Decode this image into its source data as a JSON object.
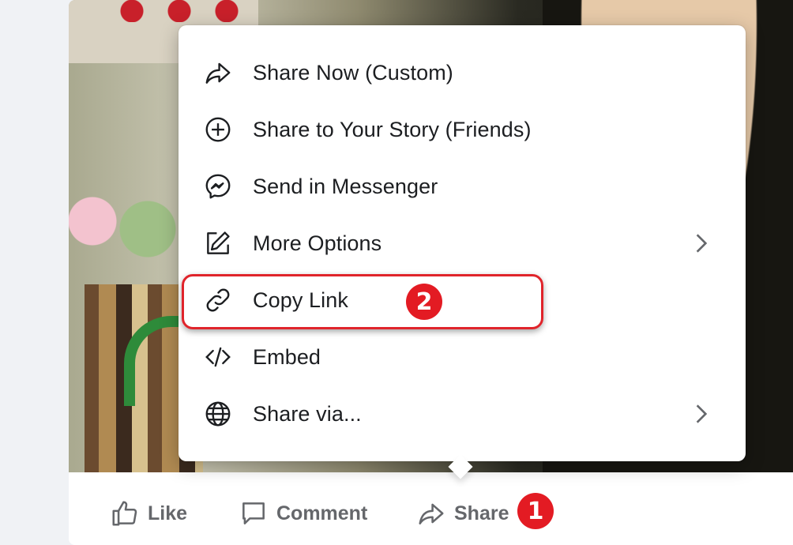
{
  "share_menu": {
    "items": [
      {
        "label": "Share Now (Custom)",
        "icon": "share-arrow-icon",
        "has_submenu": false
      },
      {
        "label": "Share to Your Story (Friends)",
        "icon": "plus-circle-icon",
        "has_submenu": false
      },
      {
        "label": "Send in Messenger",
        "icon": "messenger-icon",
        "has_submenu": false
      },
      {
        "label": "More Options",
        "icon": "edit-icon",
        "has_submenu": true
      },
      {
        "label": "Copy Link",
        "icon": "link-icon",
        "has_submenu": false
      },
      {
        "label": "Embed",
        "icon": "code-icon",
        "has_submenu": false
      },
      {
        "label": "Share via...",
        "icon": "globe-icon",
        "has_submenu": true
      }
    ]
  },
  "actions": {
    "like_label": "Like",
    "comment_label": "Comment",
    "share_label": "Share"
  },
  "annotations": {
    "step1": "1",
    "step2": "2",
    "highlight_color": "#e0242b",
    "badge_color": "#e31b23"
  }
}
